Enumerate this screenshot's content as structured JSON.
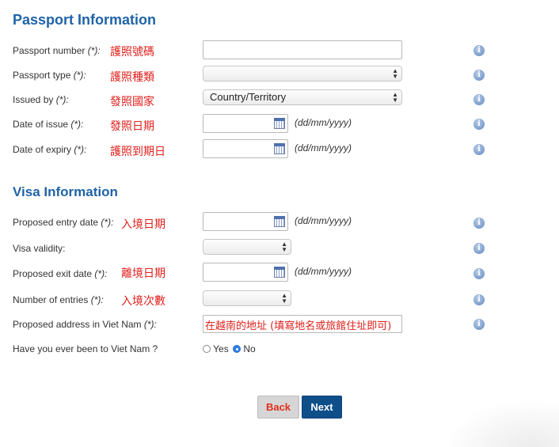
{
  "passport": {
    "heading": "Passport Information",
    "fields": [
      {
        "label": "Passport number",
        "req": "(*):",
        "note": "護照號碼"
      },
      {
        "label": "Passport type",
        "req": "(*):",
        "note": "護照種類"
      },
      {
        "label": "Issued by",
        "req": "(*):",
        "note": "發照國家"
      },
      {
        "label": "Date of issue",
        "req": "(*):",
        "note": "發照日期"
      },
      {
        "label": "Date of expiry",
        "req": "(*):",
        "note": "護照到期日"
      }
    ],
    "issued_by_value": "Country/Territory"
  },
  "visa": {
    "heading": "Visa Information",
    "fields": [
      {
        "label": "Proposed entry date",
        "req": "(*):",
        "note": "入境日期"
      },
      {
        "label": "Visa validity:",
        "req": "",
        "note": ""
      },
      {
        "label": "Proposed exit date",
        "req": "(*):",
        "note": "離境日期"
      },
      {
        "label": "Number of entries",
        "req": "(*):",
        "note": "入境次數"
      },
      {
        "label": "Proposed address in Viet Nam",
        "req": "(*):",
        "note": ""
      },
      {
        "label": "Have you ever been to Viet Nam ?",
        "req": "",
        "note": ""
      }
    ],
    "address_value": "在越南的地址 (填寫地名或旅館住址即可)",
    "radio": {
      "yes": "Yes",
      "no": "No",
      "selected": "No"
    }
  },
  "date_format": "(dd/mm/yyyy)",
  "info_glyph": "i",
  "buttons": {
    "back": "Back",
    "next": "Next"
  },
  "colors": {
    "heading": "#1f63a8",
    "note": "#e0201c",
    "next_bg": "#0e4f8a",
    "back_text": "#e0301c"
  }
}
